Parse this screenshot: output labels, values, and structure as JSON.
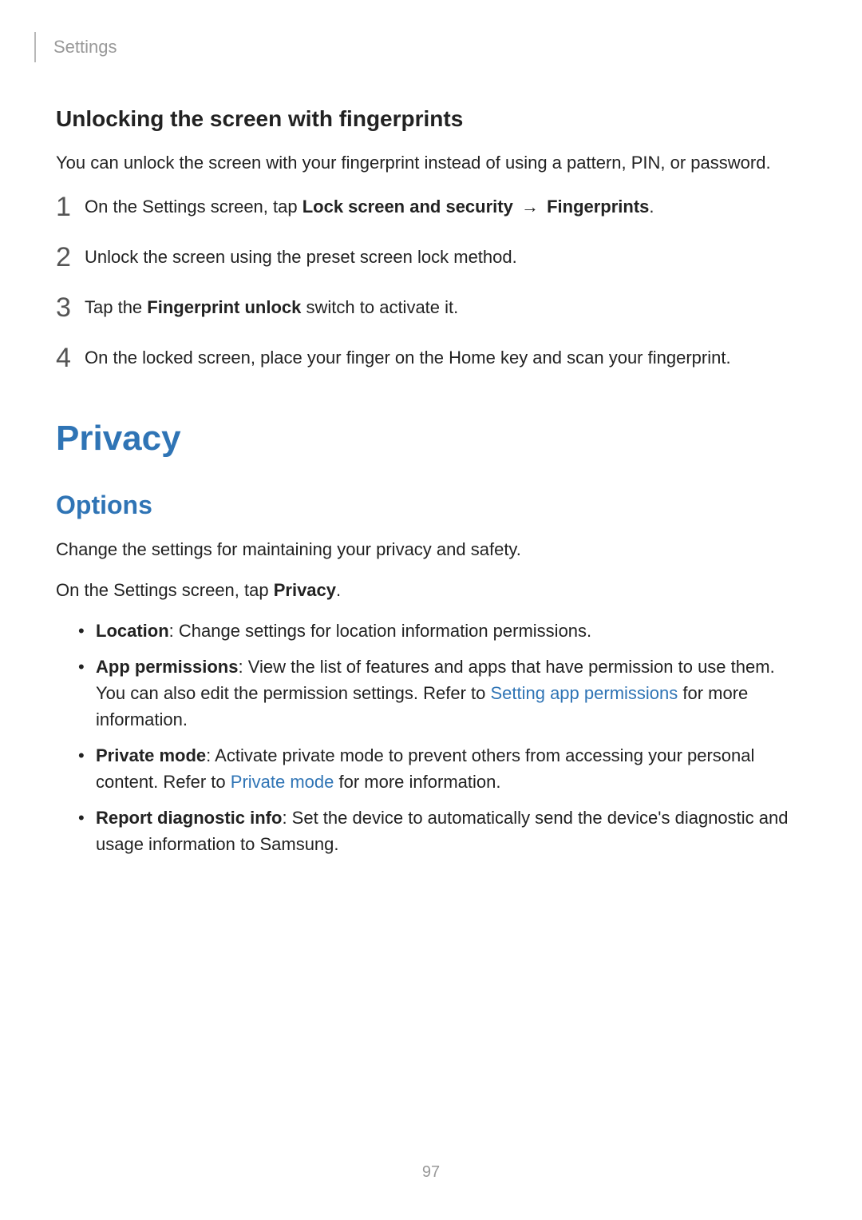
{
  "header": {
    "section": "Settings"
  },
  "fingerprint": {
    "title": "Unlocking the screen with fingerprints",
    "intro": "You can unlock the screen with your fingerprint instead of using a pattern, PIN, or password.",
    "steps": {
      "s1": {
        "num": "1",
        "pre": "On the Settings screen, tap ",
        "b1": "Lock screen and security",
        "arrow": " → ",
        "b2": "Fingerprints",
        "post": "."
      },
      "s2": {
        "num": "2",
        "text": "Unlock the screen using the preset screen lock method."
      },
      "s3": {
        "num": "3",
        "pre": "Tap the ",
        "b1": "Fingerprint unlock",
        "post": " switch to activate it."
      },
      "s4": {
        "num": "4",
        "text": "On the locked screen, place your finger on the Home key and scan your fingerprint."
      }
    }
  },
  "privacy": {
    "title": "Privacy",
    "options": {
      "title": "Options",
      "intro": "Change the settings for maintaining your privacy and safety.",
      "nav_pre": "On the Settings screen, tap ",
      "nav_bold": "Privacy",
      "nav_post": ".",
      "bullets": {
        "b1": {
          "label": "Location",
          "text": ": Change settings for location information permissions."
        },
        "b2": {
          "label": "App permissions",
          "pre": ": View the list of features and apps that have permission to use them. You can also edit the permission settings. Refer to ",
          "link": "Setting app permissions",
          "post": " for more information."
        },
        "b3": {
          "label": "Private mode",
          "pre": ": Activate private mode to prevent others from accessing your personal content. Refer to ",
          "link": "Private mode",
          "post": " for more information."
        },
        "b4": {
          "label": "Report diagnostic info",
          "text": ": Set the device to automatically send the device's diagnostic and usage information to Samsung."
        }
      }
    }
  },
  "page_number": "97"
}
